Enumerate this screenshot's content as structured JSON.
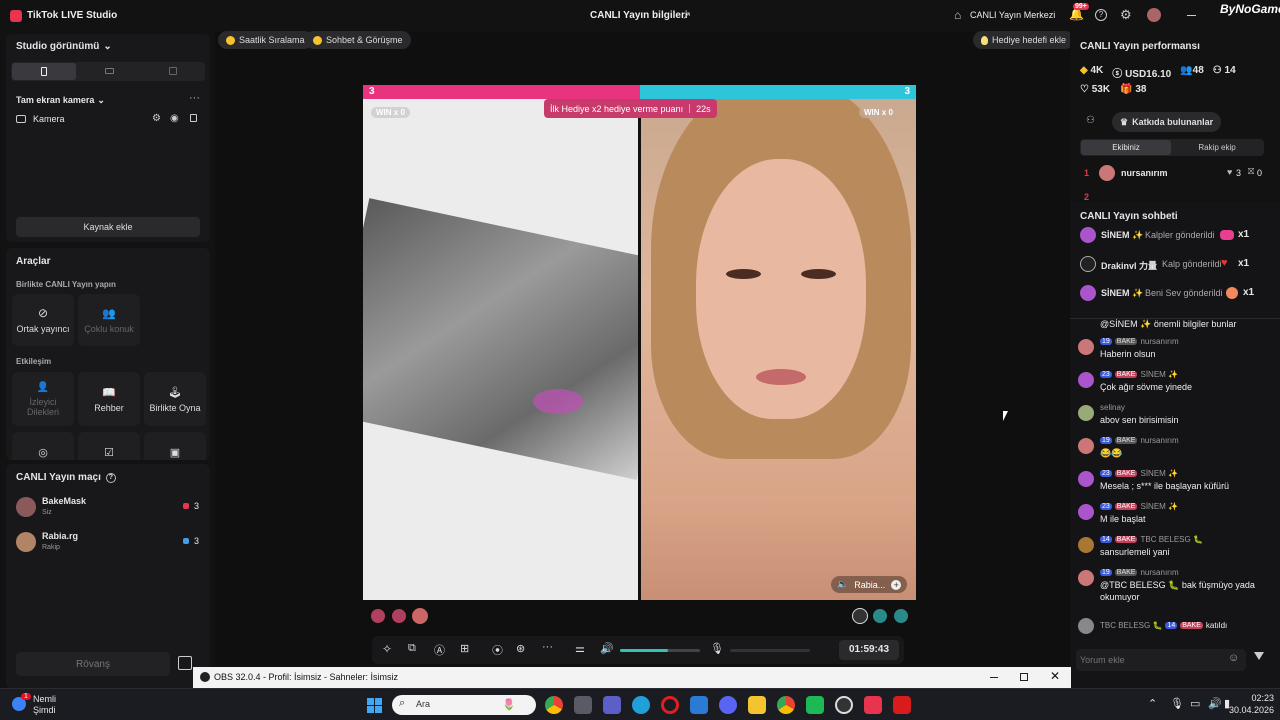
{
  "titlebar": {
    "app_name": "TikTok LIVE Studio",
    "center_title": "CANLI Yayın bilgileri",
    "live_center": "CANLI Yayın Merkezi",
    "notif_badge": "99+",
    "watermark": "ByNoGame"
  },
  "left": {
    "studio_view": "Studio görünümü",
    "fullscreen_camera": "Tam ekran kamera",
    "camera_label": "Kamera",
    "add_source": "Kaynak ekle",
    "tools_title": "Araçlar",
    "collab_title": "Birlikte CANLI Yayın yapın",
    "co_host": "Ortak yayıncı",
    "multi_guest": "Çoklu konuk",
    "interaction_title": "Etkileşim",
    "viewer_wishes": "İzleyici Dilekleri",
    "guide": "Rehber",
    "play_together": "Birlikte Oyna",
    "match_title": "CANLI Yayın maçı",
    "players": [
      {
        "name": "BakeMask",
        "sub": "Siz",
        "score": "3"
      },
      {
        "name": "Rabia.rg",
        "sub": "Rakip",
        "score": "3"
      }
    ],
    "rematch": "Rövanş"
  },
  "center": {
    "pill_hourly": "Saatlik Sıralama",
    "pill_chat": "Sohbet & Görüşme",
    "pill_gift_goal": "Hediye hedefi ekle",
    "score_left": "3",
    "score_right": "3",
    "score_share_left": 0.5,
    "banner": "İlk Hediye x2 hediye verme puanı",
    "banner_timer": "22s",
    "win_left": "WIN x 0",
    "win_right": "WIN x 0",
    "opponent_tag": "Rabia...",
    "timer": "01:59:43",
    "volume_level": 0.6
  },
  "right": {
    "perf_title": "CANLI Yayın performansı",
    "stats": {
      "diamonds": "4K",
      "usd": "USD16.10",
      "viewers": "48",
      "followers": "14",
      "likes": "53K",
      "gifts": "38"
    },
    "contributors": "Katkıda bulunanlar",
    "tab_team": "Ekibiniz",
    "tab_rival": "Rakip ekip",
    "top_contributor": {
      "rank": "1",
      "name": "nursanırım",
      "likes": "3",
      "gifts": "0"
    },
    "second_rank": "2",
    "chat_title": "CANLI Yayın sohbeti",
    "gift_events": [
      {
        "user": "SİNEM ✨",
        "text": "Kalpler gönderildi",
        "count": "x1",
        "color": "#e8408e"
      },
      {
        "user": "Drakinvl 力量",
        "text": "Kalp gönderildi",
        "count": "x1",
        "color": "#e53935"
      },
      {
        "user": "SİNEM ✨",
        "text": "Beni Sev gönderildi",
        "count": "x1",
        "color": "#f08a5d"
      }
    ],
    "chat": [
      {
        "lvl": "",
        "fan": "",
        "user": "",
        "text": "@SİNEM ✨ önemli bilgiler bunlar",
        "av": "#b56"
      },
      {
        "lvl": "19",
        "fan": "BAKE",
        "user": "nursanırım",
        "text": "Haberin olsun",
        "av": "#c77"
      },
      {
        "lvl": "23",
        "fan": "BAKE",
        "user": "SİNEM ✨",
        "text": "Çok ağır sövme yinede",
        "av": "#a5c"
      },
      {
        "lvl": "",
        "fan": "",
        "user": "selinay",
        "text": "abov sen birisimisin",
        "av": "#9a7"
      },
      {
        "lvl": "19",
        "fan": "BAKE",
        "user": "nursanırım",
        "text": "😂😂",
        "av": "#c77"
      },
      {
        "lvl": "23",
        "fan": "BAKE",
        "user": "SİNEM ✨",
        "text": "Mesela ; s*** ile başlayan küfürü",
        "av": "#a5c"
      },
      {
        "lvl": "23",
        "fan": "BAKE",
        "user": "SİNEM ✨",
        "text": "M ile başlat",
        "av": "#a5c"
      },
      {
        "lvl": "14",
        "fan": "BAKE",
        "user": "TBC BELESG 🐛",
        "text": "sansurlemeli yani",
        "av": "#a73"
      },
      {
        "lvl": "19",
        "fan": "BAKE",
        "user": "nursanırım",
        "text": "@TBC BELESG 🐛 bak füşmüyo yada",
        "text2": "okumuyor",
        "av": "#c77"
      }
    ],
    "join_user": "TBC BELESG 🐛",
    "join_lvl": "14",
    "join_fan": "BAKE",
    "join_text": "katıldı",
    "comment_placeholder": "Yorum ekle"
  },
  "obs": {
    "title": "OBS 32.0.4 - Profil: İsimsiz - Sahneler: İsimsiz"
  },
  "taskbar": {
    "notif_count": "1",
    "notif_title": "Nemli",
    "notif_sub": "Şimdi",
    "search": "Ara",
    "time": "02:23",
    "date": "30.04.2026"
  }
}
